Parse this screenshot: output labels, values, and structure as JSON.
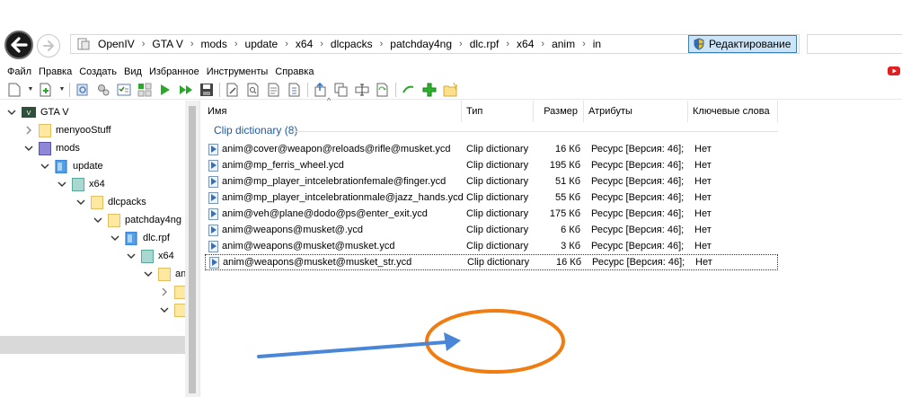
{
  "breadcrumb": {
    "items": [
      "OpenIV",
      "GTA V",
      "mods",
      "update",
      "x64",
      "dlcpacks",
      "patchday4ng",
      "dlc.rpf",
      "x64",
      "anim",
      "in"
    ],
    "separator": "›"
  },
  "edit_button": {
    "label": "Редактирование"
  },
  "search": {
    "placeholder": ""
  },
  "menu": {
    "items": [
      "Файл",
      "Правка",
      "Создать",
      "Вид",
      "Избранное",
      "Инструменты",
      "Справка"
    ]
  },
  "tree": {
    "nodes": [
      {
        "label": "GTA V",
        "icon": "gta-icon"
      },
      {
        "label": "menyooStuff",
        "icon": "folder-icon"
      },
      {
        "label": "mods",
        "icon": "mods-folder-icon"
      },
      {
        "label": "update",
        "icon": "rpf-archive-icon"
      },
      {
        "label": "x64",
        "icon": "x64-folder-icon"
      },
      {
        "label": "dlcpacks",
        "icon": "folder-icon"
      },
      {
        "label": "patchday4ng",
        "icon": "folder-icon"
      },
      {
        "label": "dlc.rpf",
        "icon": "rpf-archive-icon"
      },
      {
        "label": "x64",
        "icon": "x64-folder-icon"
      },
      {
        "label": "an",
        "icon": "folder-icon"
      }
    ]
  },
  "list": {
    "columns": [
      "Имя",
      "Тип",
      "Размер",
      "Атрибуты",
      "Ключевые слова"
    ],
    "group_label": "Clip dictionary (8)",
    "rows": [
      {
        "name": "anim@cover@weapon@reloads@rifle@musket.ycd",
        "type": "Clip dictionary",
        "size": "16 Кб",
        "attributes": "Ресурс [Версия: 46];",
        "keywords": "Нет"
      },
      {
        "name": "anim@mp_ferris_wheel.ycd",
        "type": "Clip dictionary",
        "size": "195 Кб",
        "attributes": "Ресурс [Версия: 46];",
        "keywords": "Нет"
      },
      {
        "name": "anim@mp_player_intcelebrationfemale@finger.ycd",
        "type": "Clip dictionary",
        "size": "51 Кб",
        "attributes": "Ресурс [Версия: 46];",
        "keywords": "Нет"
      },
      {
        "name": "anim@mp_player_intcelebrationmale@jazz_hands.ycd",
        "type": "Clip dictionary",
        "size": "55 Кб",
        "attributes": "Ресурс [Версия: 46];",
        "keywords": "Нет"
      },
      {
        "name": "anim@veh@plane@dodo@ps@enter_exit.ycd",
        "type": "Clip dictionary",
        "size": "175 Кб",
        "attributes": "Ресурс [Версия: 46];",
        "keywords": "Нет"
      },
      {
        "name": "anim@weapons@musket@.ycd",
        "type": "Clip dictionary",
        "size": "6 Кб",
        "attributes": "Ресурс [Версия: 46];",
        "keywords": "Нет"
      },
      {
        "name": "anim@weapons@musket@musket.ycd",
        "type": "Clip dictionary",
        "size": "3 Кб",
        "attributes": "Ресурс [Версия: 46];",
        "keywords": "Нет"
      },
      {
        "name": "anim@weapons@musket@musket_str.ycd",
        "type": "Clip dictionary",
        "size": "16 Кб",
        "attributes": "Ресурс [Версия: 46];",
        "keywords": "Нет"
      }
    ]
  },
  "colors": {
    "accent_blue": "#1e5aa8",
    "annotation_orange": "#f07c12",
    "annotation_blue": "#4a86d8",
    "selection_grey": "#d9d9d9"
  }
}
